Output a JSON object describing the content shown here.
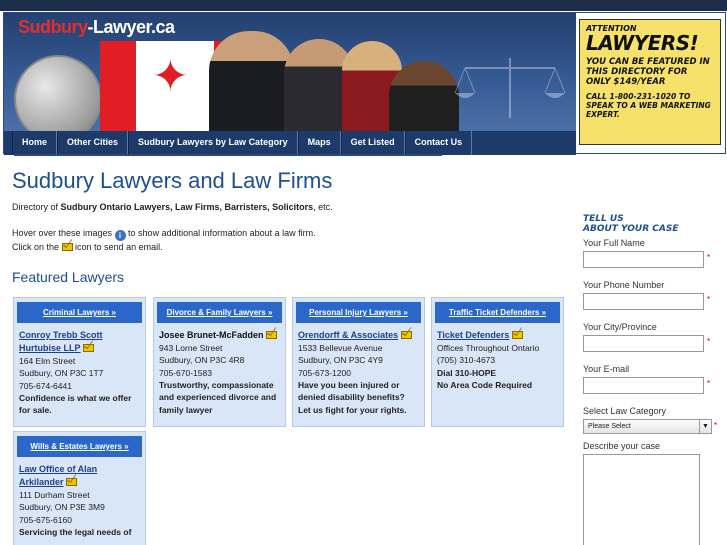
{
  "header": {
    "logo_part1": "Sudbury",
    "logo_part2": "-Lawyer.ca",
    "nav": [
      "Home",
      "Other Cities",
      "Sudbury Lawyers by Law Category",
      "Maps",
      "Get Listed",
      "Contact Us"
    ]
  },
  "ad": {
    "attention": "ATTENTION",
    "headline": "LAWYERS!",
    "pitch": "YOU CAN BE FEATURED IN THIS DIRECTORY FOR ONLY $149/YEAR",
    "call": "CALL 1-800-231-1020 TO SPEAK TO A WEB MARKETING EXPERT."
  },
  "main": {
    "title": "Sudbury Lawyers and Law Firms",
    "intro_prefix": "Directory of ",
    "intro_bold": "Sudbury Ontario Lawyers, Law Firms, Barristers, Solicitors",
    "intro_suffix": ", etc.",
    "hint1_a": "Hover over these images ",
    "hint1_b": " to show additional information about a law firm.",
    "hint2_a": "Click on the ",
    "hint2_b": " icon to send an email.",
    "featured_heading": "Featured Lawyers"
  },
  "cards": [
    {
      "category": "Criminal Lawyers »",
      "name": "Conroy Trebb Scott Hurtubise LLP",
      "linked": true,
      "address": "164 Elm Street",
      "city": "Sudbury, ON P3C 1T7",
      "phone": "705-674-6441",
      "desc": "Confidence is what we offer for sale."
    },
    {
      "category": "Divorce & Family Lawyers »",
      "name": "Josee Brunet-McFadden",
      "linked": false,
      "address": "943 Lorne Street",
      "city": "Sudbury, ON P3C 4R8",
      "phone": "705-670-1583",
      "desc": "Trustworthy, compassionate and experienced divorce and family lawyer"
    },
    {
      "category": "Personal Injury Lawyers »",
      "name": "Orendorff & Associates",
      "linked": true,
      "address": "1533 Bellevue Avenue",
      "city": "Sudbury, ON P3C 4Y9",
      "phone": "705-673-1200",
      "desc": "Have you been injured or denied disability benefits? Let us fight for your rights."
    },
    {
      "category": "Traffic Ticket Defenders »",
      "name": "Ticket Defenders",
      "linked": true,
      "address": "Offices Throughout Ontario",
      "city": "(705) 310-4673",
      "phone": "Dial 310-HOPE",
      "desc": "No Area Code Required"
    },
    {
      "category": "Wills & Estates Lawyers »",
      "name": "Law Office of Alan Arkilander",
      "linked": true,
      "address": "111 Durham Street",
      "city": "Sudbury, ON P3E 3M9",
      "phone": "705-675-6160",
      "desc": "Servicing the legal needs of"
    }
  ],
  "form": {
    "tell1": "TELL US",
    "tell2": "ABOUT YOUR CASE",
    "full_name": "Your Full Name",
    "phone": "Your Phone Number",
    "city": "Your City/Province",
    "email": "Your E-mail",
    "category_label": "Select Law Category",
    "category_value": "Please Select",
    "describe": "Describe your case",
    "required_mark": "*"
  },
  "colors": {
    "accent": "#1e4f8f",
    "card_header": "#2b66c9",
    "card_bg": "#d9e6f7",
    "ad_bg": "#f6e26b"
  }
}
